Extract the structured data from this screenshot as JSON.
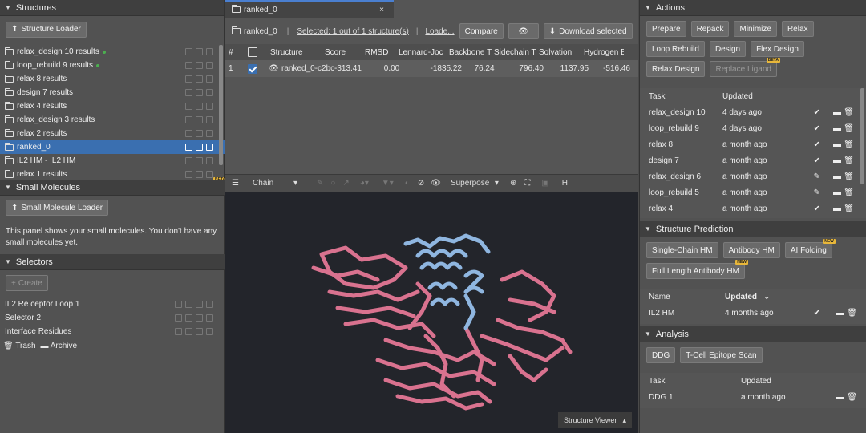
{
  "left": {
    "structures": {
      "title": "Structures",
      "loader": "Structure Loader",
      "items": [
        {
          "label": "relax_design 10 results",
          "dot": true
        },
        {
          "label": "loop_rebuild 9 results",
          "dot": true
        },
        {
          "label": "relax 8 results",
          "dot": false
        },
        {
          "label": "design 7 results",
          "dot": false
        },
        {
          "label": "relax 4 results",
          "dot": false
        },
        {
          "label": "relax_design 3 results",
          "dot": false
        },
        {
          "label": "relax 2 results",
          "dot": false
        },
        {
          "label": "ranked_0",
          "dot": false
        },
        {
          "label": "IL2 HM - IL2 HM",
          "dot": false
        },
        {
          "label": "relax 1 results",
          "dot": false
        }
      ]
    },
    "beta": "BETA",
    "molecules": {
      "title": "Small Molecules",
      "loader": "Small Molecule Loader",
      "desc": "This panel shows your small molecules. You don't have any small molecules yet."
    },
    "selectors": {
      "title": "Selectors",
      "create": "Create",
      "items": [
        "IL2 Re ceptor Loop 1",
        "Selector 2",
        "Interface Residues"
      ]
    },
    "trash": "Trash",
    "archive": "Archive"
  },
  "mid": {
    "tab": "ranked_0",
    "toolbar": {
      "name": "ranked_0",
      "selected": "Selected: 1 out of 1 structure(s)",
      "loading": "Loade...",
      "compare": "Compare",
      "download": "Download selected"
    },
    "columns": [
      "#",
      "",
      "Structure",
      "Score",
      "RMSD",
      "Lennard-Joᴄ",
      "Backbone T",
      "Sidechain T",
      "Solvation",
      "Hydrogen B"
    ],
    "row": {
      "num": "1",
      "structure": "ranked_0-c2bc",
      "score": "-313.41",
      "rmsd": "0.00",
      "lj": "-1835.22",
      "bb": "76.24",
      "sc": "796.40",
      "solv": "1137.95",
      "hb": "-516.46"
    },
    "viewer": {
      "chain": "Chain",
      "superpose": "Superpose",
      "h": "H",
      "footer": "Structure Viewer"
    }
  },
  "right": {
    "actions": {
      "title": "Actions",
      "buttons": [
        "Prepare",
        "Repack",
        "Minimize",
        "Relax",
        "Loop Rebuild",
        "Design",
        "Flex Design",
        "Relax Design",
        "Replace Ligand"
      ],
      "head_task": "Task",
      "head_updated": "Updated",
      "tasks": [
        {
          "task": "relax_design 10",
          "updated": "4 days ago",
          "status": "check"
        },
        {
          "task": "loop_rebuild 9",
          "updated": "4 days ago",
          "status": "check"
        },
        {
          "task": "relax 8",
          "updated": "a month ago",
          "status": "check"
        },
        {
          "task": "design 7",
          "updated": "a month ago",
          "status": "check"
        },
        {
          "task": "relax_design 6",
          "updated": "a month ago",
          "status": "pencil"
        },
        {
          "task": "loop_rebuild 5",
          "updated": "a month ago",
          "status": "pencil"
        },
        {
          "task": "relax 4",
          "updated": "a month ago",
          "status": "check"
        }
      ]
    },
    "prediction": {
      "title": "Structure Prediction",
      "buttons": [
        "Single-Chain HM",
        "Antibody HM",
        "AI Folding",
        "Full Length Antibody HM"
      ],
      "new": "NEW",
      "head_name": "Name",
      "head_updated": "Updated",
      "row": {
        "name": "IL2 HM",
        "updated": "4 months ago"
      }
    },
    "analysis": {
      "title": "Analysis",
      "buttons": [
        "DDG",
        "T-Cell Epitope Scan"
      ],
      "head_task": "Task",
      "head_updated": "Updated",
      "row": {
        "task": "DDG 1",
        "updated": "a month ago"
      }
    }
  },
  "colors": {
    "accent": "#3a6fb0",
    "helix": "#8fb6e0",
    "sheet": "#d9728f",
    "viewer_bg": "#23252b"
  }
}
